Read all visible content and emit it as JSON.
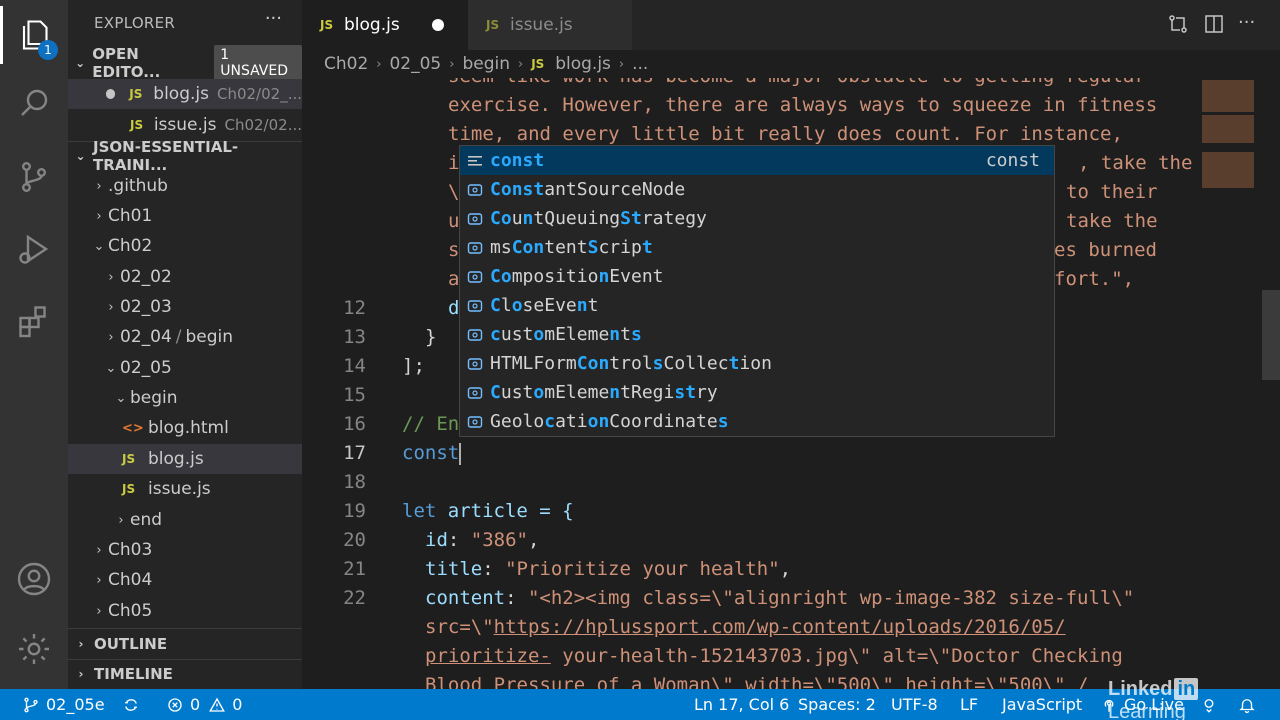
{
  "explorer": {
    "title": "EXPLORER",
    "more_icon": "ellipsis-icon",
    "open_editors": {
      "label": "OPEN EDITO...",
      "badge": "1 UNSAVED",
      "files": [
        {
          "name": "blog.js",
          "path": "Ch02/02_...",
          "unsaved": true
        },
        {
          "name": "issue.js",
          "path": "Ch02/02..."
        }
      ]
    },
    "project": {
      "label": "JSON-ESSENTIAL-TRAINI...",
      "tree": [
        {
          "label": ".github"
        },
        {
          "label": "Ch01"
        },
        {
          "label": "Ch02"
        },
        {
          "label": "02_02"
        },
        {
          "label": "02_03"
        },
        {
          "label": "02_04",
          "suffix": "begin"
        },
        {
          "label": "02_05"
        },
        {
          "label": "begin"
        },
        {
          "label": "blog.html"
        },
        {
          "label": "blog.js"
        },
        {
          "label": "issue.js"
        },
        {
          "label": "end"
        },
        {
          "label": "Ch03"
        },
        {
          "label": "Ch04"
        },
        {
          "label": "Ch05"
        }
      ]
    },
    "outline": "OUTLINE",
    "timeline": "TIMELINE"
  },
  "activity_badge": "1",
  "tabs": [
    {
      "label": "blog.js",
      "lang": "JS",
      "active": true,
      "unsaved": true
    },
    {
      "label": "issue.js",
      "lang": "JS",
      "active": false
    }
  ],
  "breadcrumb": [
    "Ch02",
    "02_05",
    "begin",
    "blog.js",
    "..."
  ],
  "editor": {
    "wrapped_top": [
      "seem like work has become a major obstacle to getting regular",
      "exercise. However, there are always ways to squeeze in fitness",
      "time, and every little bit really does count. For instance,"
    ],
    "partial_left": [
      "i",
      "\\",
      "u",
      "s",
      "a",
      "d"
    ],
    "partial_right": [
      ", take the",
      "to their",
      "take the",
      "es burned",
      "fort.\","
    ],
    "lines": {
      "n12": "12",
      "n13": "13",
      "n14": "14",
      "n15": "15",
      "n16": "16",
      "n17": "17",
      "n18": "18",
      "n19": "19",
      "n20": "20",
      "n21": "21",
      "n22": "22",
      "l13": "}",
      "l14": "];",
      "l16": "// En",
      "l17": "const",
      "l19_kw": "let",
      "l19_rest": " article = {",
      "l20_key": "id",
      "l20_val": "\"386\"",
      "l21_key": "title",
      "l21_val": "\"Prioritize your health\"",
      "l22_key": "content",
      "l22_val": "\"<h2><img class=\\\"alignright wp-image-382 size-full\\\"",
      "l22b_pre": "src=\\\"",
      "l22b_link": "https://hplussport.com/wp-content/uploads/2016/05/",
      "l22c_link": "prioritize-",
      "l22c_rest": " your-health-152143703.jpg\\\" alt=\\\"Doctor Checking",
      "l22d": "Blood Pressure of a Woman\\\" width=\\\"500\\\" height=\\\"500\\\" /"
    }
  },
  "suggestions": {
    "detail": "const",
    "items": [
      "const",
      "ConstantSourceNode",
      "CountQueuingStrategy",
      "msContentScript",
      "CompositionEvent",
      "CloseEvent",
      "customElements",
      "HTMLFormControlsCollection",
      "CustomElementRegistry",
      "GeolocationCoordinates"
    ]
  },
  "status": {
    "branch": "02_05e",
    "errors": "0",
    "warnings": "0",
    "position": "Ln 17, Col 6",
    "spaces": "Spaces: 2",
    "encoding": "UTF-8",
    "eol": "LF",
    "language": "JavaScript",
    "go_live": "Go Live"
  },
  "watermark": {
    "pre": "Linked",
    "in": "in",
    "post": " Learning"
  },
  "colors": {
    "accent": "#007acc",
    "string": "#ce9178",
    "keyword": "#569cd6",
    "property": "#9cdcfe",
    "comment": "#6a9955",
    "match": "#2aaaff"
  }
}
